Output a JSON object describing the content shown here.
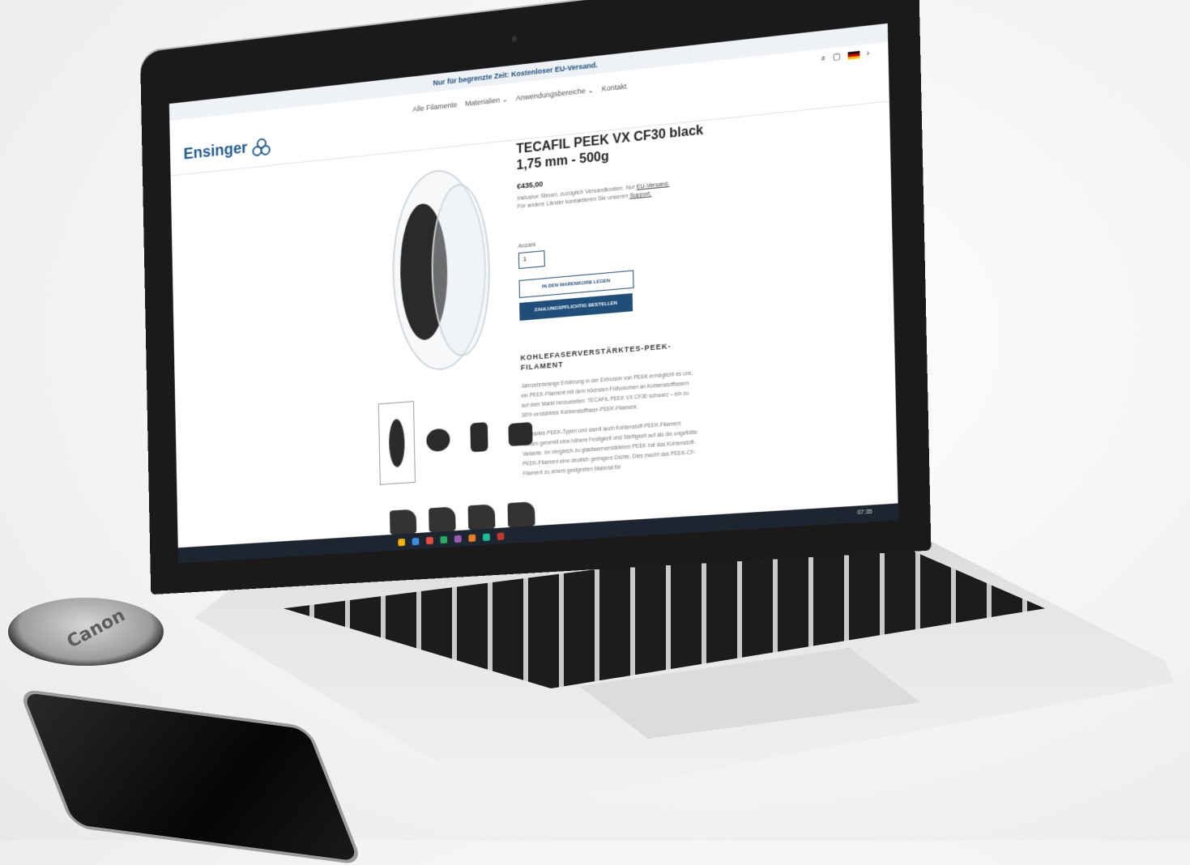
{
  "site": {
    "promo": "Nur für begrenzte Zeit: Kostenloser EU-Versand.",
    "logo_text": "Ensinger",
    "nav": [
      "Alle Filamente",
      "Materialien ⌄",
      "Anwendungsbereiche ⌄",
      "Kontakt"
    ],
    "tools": {
      "search_icon": "⌕",
      "cart_icon": "▢",
      "lang_arrow": "›"
    }
  },
  "product": {
    "title_line1": "TECAFIL PEEK VX CF30 black",
    "title_line2": "1,75 mm - 500g",
    "price": "€435,00",
    "tax_line1_prefix": "Inklusive Steuer, zuzüglich Versandkosten. Nur ",
    "tax_line1_link": "EU-Versand.",
    "tax_line2_prefix": "Für andere Länder kontaktieren Sie unseren ",
    "tax_line2_link": "Support.",
    "qty_label": "Anzahl",
    "qty_value": "1",
    "add_to_cart": "IN DEN WARENKORB LEGEN",
    "buy_now": "ZAHLUNGSPFLICHTIG BESTELLEN",
    "section_title": "KOHLEFASERVERSTÄRKTES-PEEK-FILAMENT",
    "paragraph1": "Jahrzehntelange Erfahrung in der Extrusion von PEEK ermöglicht es uns, ein PEEK-Filament mit dem höchsten Füllvolumen an Kohlenstofffasern auf dem Markt herzustellen: TECAFIL PEEK VX CF30 schwarz – ein zu 30% verstärktes Kohlenstofffaser-PEEK-Filament.",
    "paragraph2": "Verstärkte PEEK-Typen und damit auch Kohlenstoff-PEEK-Filament weisen generell eine höhere Festigkeit und Steifigkeit auf als die ungefüllte Variante. Im Vergleich zu glasfaserverstärktem PEEK hat das Kohlenstoff-PEEK-Filament eine deutlich geringere Dichte. Dies macht das PEEK-CF-Filament zu einem geeigneten Material für"
  },
  "taskbar": {
    "clock": "07:35"
  },
  "lens_cap_text": "Canon",
  "colors": {
    "brand": "#1f5a8e",
    "button": "#1f4e7a"
  }
}
